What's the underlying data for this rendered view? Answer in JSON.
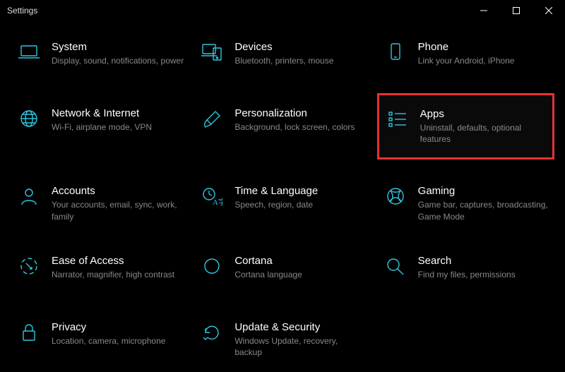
{
  "window_title": "Settings",
  "accent": "#2fc6e0",
  "highlight_border": "#e63232",
  "highlighted_id": "apps",
  "tiles": [
    {
      "id": "system",
      "icon": "laptop-icon",
      "title": "System",
      "desc": "Display, sound, notifications, power"
    },
    {
      "id": "devices",
      "icon": "devices-icon",
      "title": "Devices",
      "desc": "Bluetooth, printers, mouse"
    },
    {
      "id": "phone",
      "icon": "phone-icon",
      "title": "Phone",
      "desc": "Link your Android, iPhone"
    },
    {
      "id": "network",
      "icon": "globe-icon",
      "title": "Network & Internet",
      "desc": "Wi-Fi, airplane mode, VPN"
    },
    {
      "id": "personalization",
      "icon": "paintbrush-icon",
      "title": "Personalization",
      "desc": "Background, lock screen, colors"
    },
    {
      "id": "apps",
      "icon": "apps-list-icon",
      "title": "Apps",
      "desc": "Uninstall, defaults, optional features"
    },
    {
      "id": "accounts",
      "icon": "person-icon",
      "title": "Accounts",
      "desc": "Your accounts, email, sync, work, family"
    },
    {
      "id": "time",
      "icon": "time-language-icon",
      "title": "Time & Language",
      "desc": "Speech, region, date"
    },
    {
      "id": "gaming",
      "icon": "xbox-icon",
      "title": "Gaming",
      "desc": "Game bar, captures, broadcasting, Game Mode"
    },
    {
      "id": "ease",
      "icon": "ease-access-icon",
      "title": "Ease of Access",
      "desc": "Narrator, magnifier, high contrast"
    },
    {
      "id": "cortana",
      "icon": "cortana-icon",
      "title": "Cortana",
      "desc": "Cortana language"
    },
    {
      "id": "search",
      "icon": "search-icon",
      "title": "Search",
      "desc": "Find my files, permissions"
    },
    {
      "id": "privacy",
      "icon": "lock-icon",
      "title": "Privacy",
      "desc": "Location, camera, microphone"
    },
    {
      "id": "update",
      "icon": "update-icon",
      "title": "Update & Security",
      "desc": "Windows Update, recovery, backup"
    }
  ]
}
